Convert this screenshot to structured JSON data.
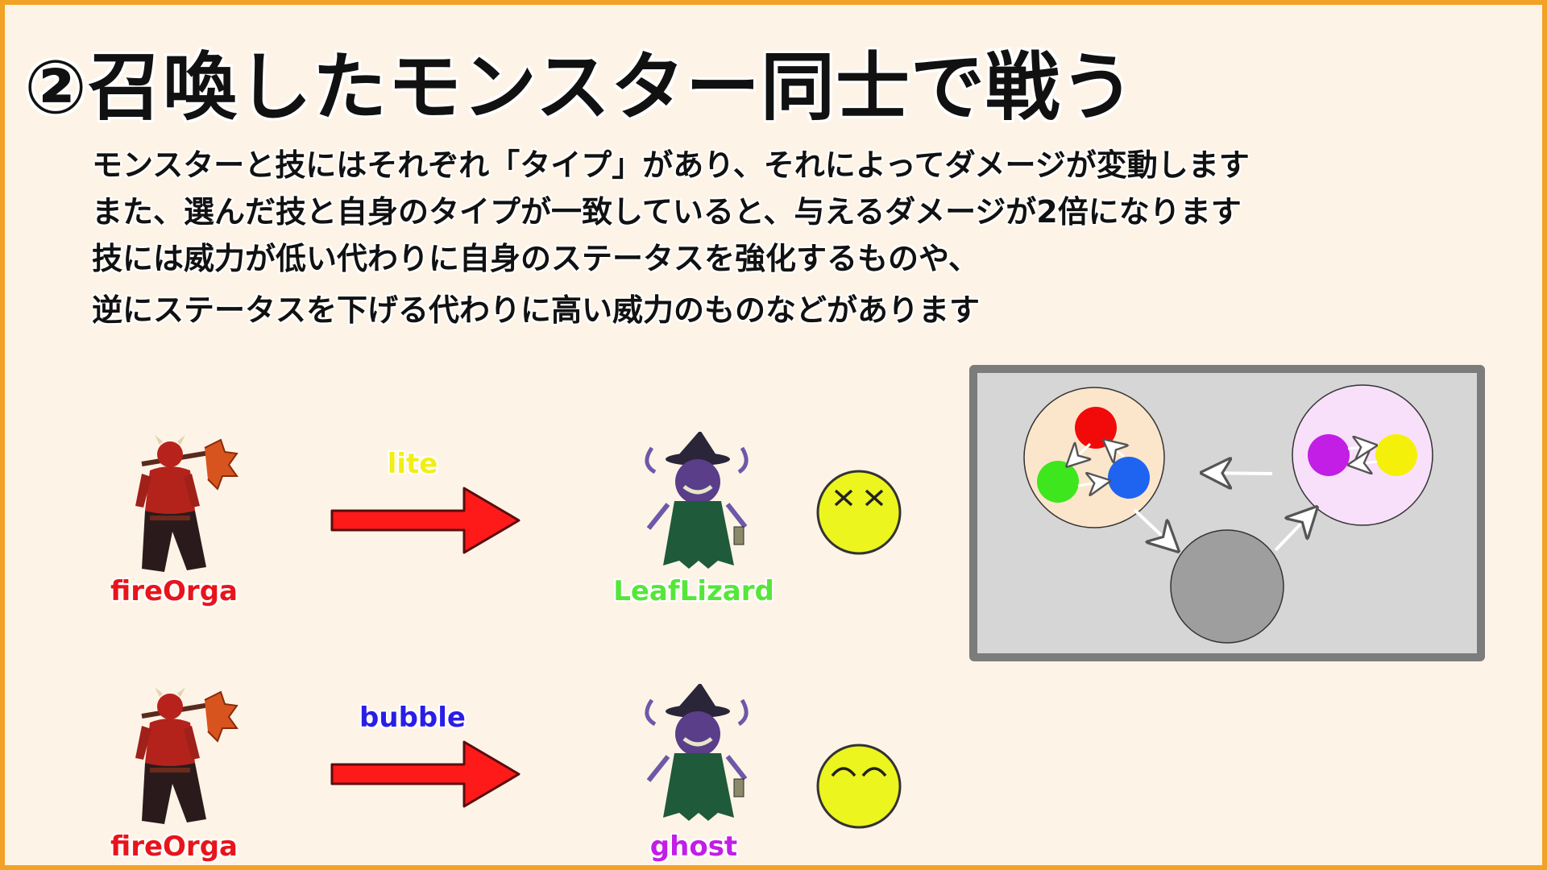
{
  "title": "②召喚したモンスター同士で戦う",
  "description": [
    "モンスターと技にはそれぞれ「タイプ」があり、それによってダメージが変動します",
    "また、選んだ技と自身のタイプが一致していると、与えるダメージが2倍になります",
    "技には威力が低い代わりに自身のステータスを強化するものや、",
    "逆にステータスを下げる代わりに高い威力のものなどがあります"
  ],
  "battles": [
    {
      "attacker": "fireOrga",
      "move": "lite",
      "defender": "LeafLizard",
      "result_face": "knocked-out-face-icon"
    },
    {
      "attacker": "fireOrga",
      "move": "bubble",
      "defender": "ghost",
      "result_face": "smiling-face-icon"
    }
  ],
  "colors": {
    "fire": "#e8141c",
    "leaf": "#55e63a",
    "ghost": "#c21ee6",
    "lite_move": "#f2ee14",
    "bubble_move": "#2a1ee6",
    "arrow_red": "#ff1a1a",
    "face_yellow": "#ecf51e",
    "border_orange": "#f2a224",
    "background": "#fdf4e7"
  },
  "type_diagram": {
    "circles": [
      "red",
      "green",
      "blue",
      "purple",
      "yellow",
      "gray"
    ]
  }
}
